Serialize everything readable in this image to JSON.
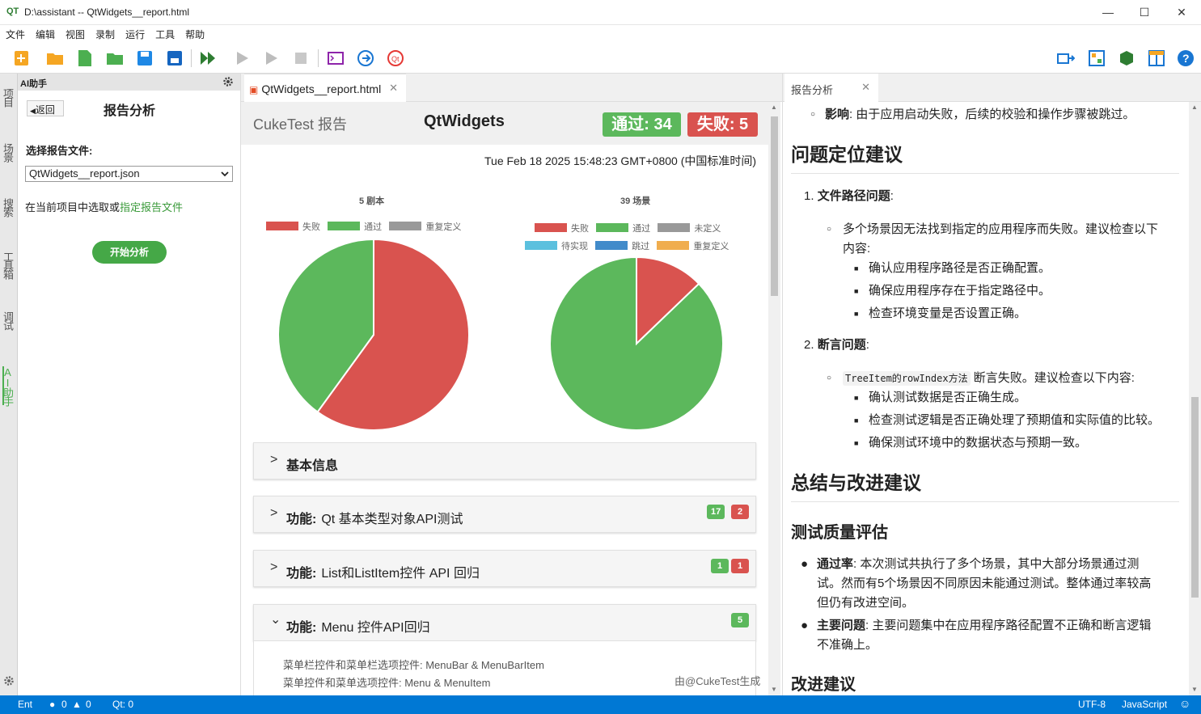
{
  "window": {
    "logo": "QT",
    "title": "D:\\assistant -- QtWidgets__report.html"
  },
  "menu": [
    "文件",
    "编辑",
    "视图",
    "录制",
    "运行",
    "工具",
    "帮助"
  ],
  "sidebar_tabs": [
    "项目",
    "场景",
    "搜索",
    "工具箱",
    "调试",
    "AI助手"
  ],
  "ai_panel": {
    "header": "AI助手",
    "back_label": "返回",
    "title": "报告分析",
    "select_label": "选择报告文件:",
    "select_value": "QtWidgets__report.json",
    "hint_prefix": "在当前项目中选取或",
    "hint_link": "指定报告文件",
    "start_button": "开始分析"
  },
  "center": {
    "tab_label": "QtWidgets__report.html",
    "brand": "CukeTest 报告",
    "project": "QtWidgets",
    "pass_badge": "通过: 34",
    "fail_badge": "失败: 5",
    "timestamp": "Tue Feb 18 2025 15:48:23 GMT+0800 (中国标准时间)",
    "panels": [
      {
        "chevron": ">",
        "prefix": "",
        "title": "基本信息",
        "counts": []
      },
      {
        "chevron": ">",
        "prefix": "功能:",
        "title": "Qt 基本类型对象API测试",
        "counts": [
          {
            "v": "17",
            "c": "g"
          },
          {
            "v": "2",
            "c": "r"
          }
        ]
      },
      {
        "chevron": ">",
        "prefix": "功能:",
        "title": "List和ListItem控件 API 回归",
        "counts": [
          {
            "v": "1",
            "c": "g"
          },
          {
            "v": "1",
            "c": "r"
          }
        ]
      },
      {
        "chevron": "⌄",
        "prefix": "功能:",
        "title": "Menu 控件API回归",
        "counts": [
          {
            "v": "5",
            "c": "g"
          }
        ]
      }
    ],
    "panel_body": [
      "菜单栏控件和菜单栏选项控件: MenuBar & MenuBarItem",
      "菜单控件和菜单选项控件: Menu & MenuItem"
    ],
    "footer": "由@CukeTest生成"
  },
  "chart_data": [
    {
      "type": "pie",
      "title": "5 剧本",
      "legend": [
        "失败",
        "通过",
        "重复定义"
      ],
      "series": [
        {
          "values": [
            {
              "label": "失败",
              "value": 3,
              "color": "#d9534f"
            },
            {
              "label": "通过",
              "value": 2,
              "color": "#5cb85c"
            }
          ]
        }
      ]
    },
    {
      "type": "pie",
      "title": "39 场景",
      "legend": [
        "失败",
        "通过",
        "未定义",
        "待实现",
        "跳过",
        "重复定义"
      ],
      "series": [
        {
          "values": [
            {
              "label": "失败",
              "value": 5,
              "color": "#d9534f"
            },
            {
              "label": "通过",
              "value": 34,
              "color": "#5cb85c"
            }
          ]
        }
      ]
    }
  ],
  "legend_colors": {
    "失败": "#d9534f",
    "通过": "#5cb85c",
    "重复定义": "#999999",
    "未定义": "#999999",
    "待实现": "#5bc0de",
    "跳过": "#428bca",
    "重复定义2": "#f0ad4e"
  },
  "right": {
    "tab_label": "报告分析",
    "impact_label": "影响",
    "impact_text": ": 由于应用启动失败，后续的校验和操作步骤被跳过。",
    "h_locate": "问题定位建议",
    "item1_title": "文件路径问题",
    "item1_desc1": "多个场景因无法找到指定的应用程序而失败。建议检查以下",
    "item1_desc2": "内容:",
    "item1_bullets": [
      "确认应用程序路径是否正确配置。",
      "确保应用程序存在于指定路径中。",
      "检查环境变量是否设置正确。"
    ],
    "item2_title": "断言问题",
    "item2_code1": "TreeItem",
    "item2_code2": "的",
    "item2_code3": "rowIndex",
    "item2_code4": "方法",
    "item2_desc": "断言失败。建议检查以下内容:",
    "item2_bullets": [
      "确认测试数据是否正确生成。",
      "检查测试逻辑是否正确处理了预期值和实际值的比较。",
      "确保测试环境中的数据状态与预期一致。"
    ],
    "h_summary": "总结与改进建议",
    "h_quality": "测试质量评估",
    "pass_label": "通过率",
    "pass_text1": ": 本次测试共执行了多个场景，其中大部分场景通过测",
    "pass_text2": "试。然而有5个场景因不同原因未能通过测试。整体通过率较高",
    "pass_text3": "但仍有改进空间。",
    "issue_label": "主要问题",
    "issue_text1": ": 主要问题集中在应用程序路径配置不正确和断言逻辑",
    "issue_text2": "不准确上。",
    "h_improve": "改进建议"
  },
  "statusbar": {
    "mode": "Ent",
    "errors": "0",
    "warnings": "0",
    "qt": "Qt: 0",
    "encoding": "UTF-8",
    "language": "JavaScript"
  }
}
